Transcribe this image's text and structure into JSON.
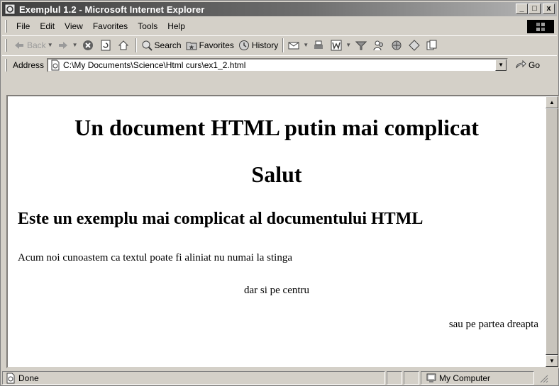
{
  "window": {
    "title": "Exemplul 1.2 - Microsoft Internet Explorer",
    "title_icon": "ie-page-icon",
    "buttons": {
      "minimize": "_",
      "maximize": "□",
      "close": "x"
    }
  },
  "menu": {
    "items": [
      {
        "name": "menu-file",
        "label": "File"
      },
      {
        "name": "menu-edit",
        "label": "Edit"
      },
      {
        "name": "menu-view",
        "label": "View"
      },
      {
        "name": "menu-favorites",
        "label": "Favorites"
      },
      {
        "name": "menu-tools",
        "label": "Tools"
      },
      {
        "name": "menu-help",
        "label": "Help"
      }
    ]
  },
  "toolbar": {
    "back_label": "Back",
    "search_label": "Search",
    "favorites_label": "Favorites",
    "history_label": "History"
  },
  "address": {
    "label": "Address",
    "value": "C:\\My Documents\\Science\\Html curs\\ex1_2.html",
    "go_label": "Go"
  },
  "page": {
    "heading1": "Un document HTML putin mai complicat",
    "heading2": "Salut",
    "heading3": "Este un exemplu mai complicat al documentului HTML",
    "para_left": "Acum noi cunoastem ca textul poate fi aliniat nu numai la stinga",
    "para_center": "dar si pe centru",
    "para_right": "sau pe partea dreapta"
  },
  "status": {
    "text": "Done",
    "zone": "My Computer"
  },
  "colors": {
    "chrome": "#d4d0c8",
    "title_start": "#404040",
    "title_end": "#b8b8b8"
  }
}
